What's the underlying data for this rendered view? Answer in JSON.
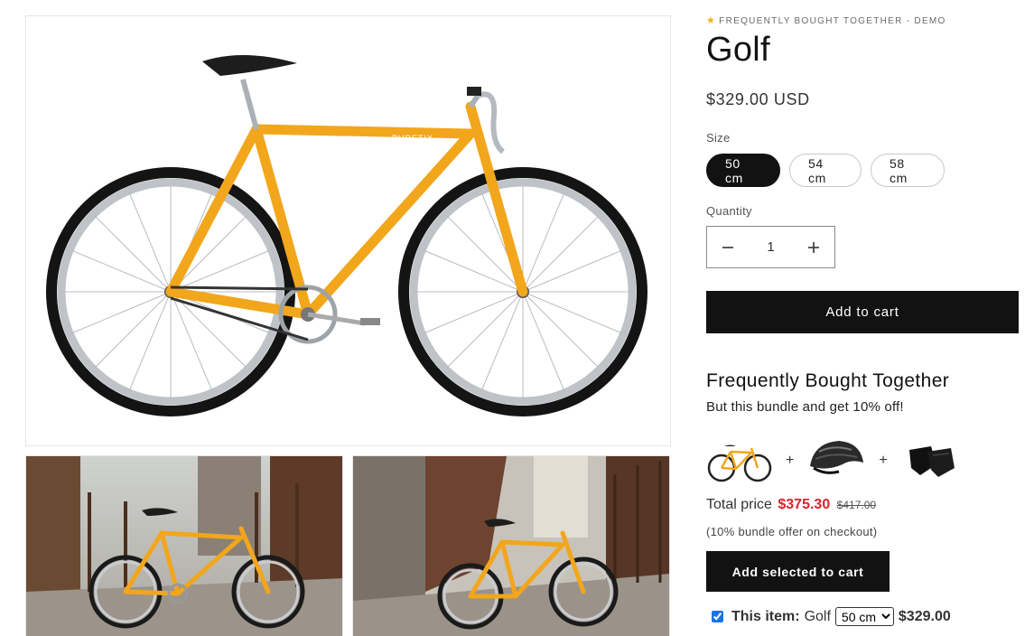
{
  "product": {
    "vendor": "Frequently bought together - Demo",
    "vendor_icon": "star-icon",
    "title": "Golf",
    "price": "$329.00 USD"
  },
  "size": {
    "label": "Size",
    "options": [
      "50 cm",
      "54 cm",
      "58 cm"
    ],
    "selected": "50 cm"
  },
  "quantity": {
    "label": "Quantity",
    "value": "1",
    "minus_icon": "minus-icon",
    "plus_icon": "plus-icon"
  },
  "add_to_cart_label": "Add to cart",
  "fbt": {
    "title": "Frequently Bought Together",
    "subtitle": "But this bundle and get 10% off!",
    "items": [
      "bicycle-thumbnail",
      "helmet-thumbnail",
      "gloves-thumbnail"
    ],
    "separator": "+",
    "total_label": "Total price",
    "total_sale": "$375.30",
    "total_original": "$417.00",
    "bundle_note": "(10% bundle offer on checkout)",
    "add_selected_label": "Add selected to cart",
    "this_item_label": "This item:",
    "this_item_name": "Golf",
    "this_item_size": "50 cm",
    "this_item_price": "$329.00"
  },
  "colors": {
    "accent_dark": "#121212",
    "sale_red": "#d9232d",
    "bike_orange": "#f2a61c"
  }
}
